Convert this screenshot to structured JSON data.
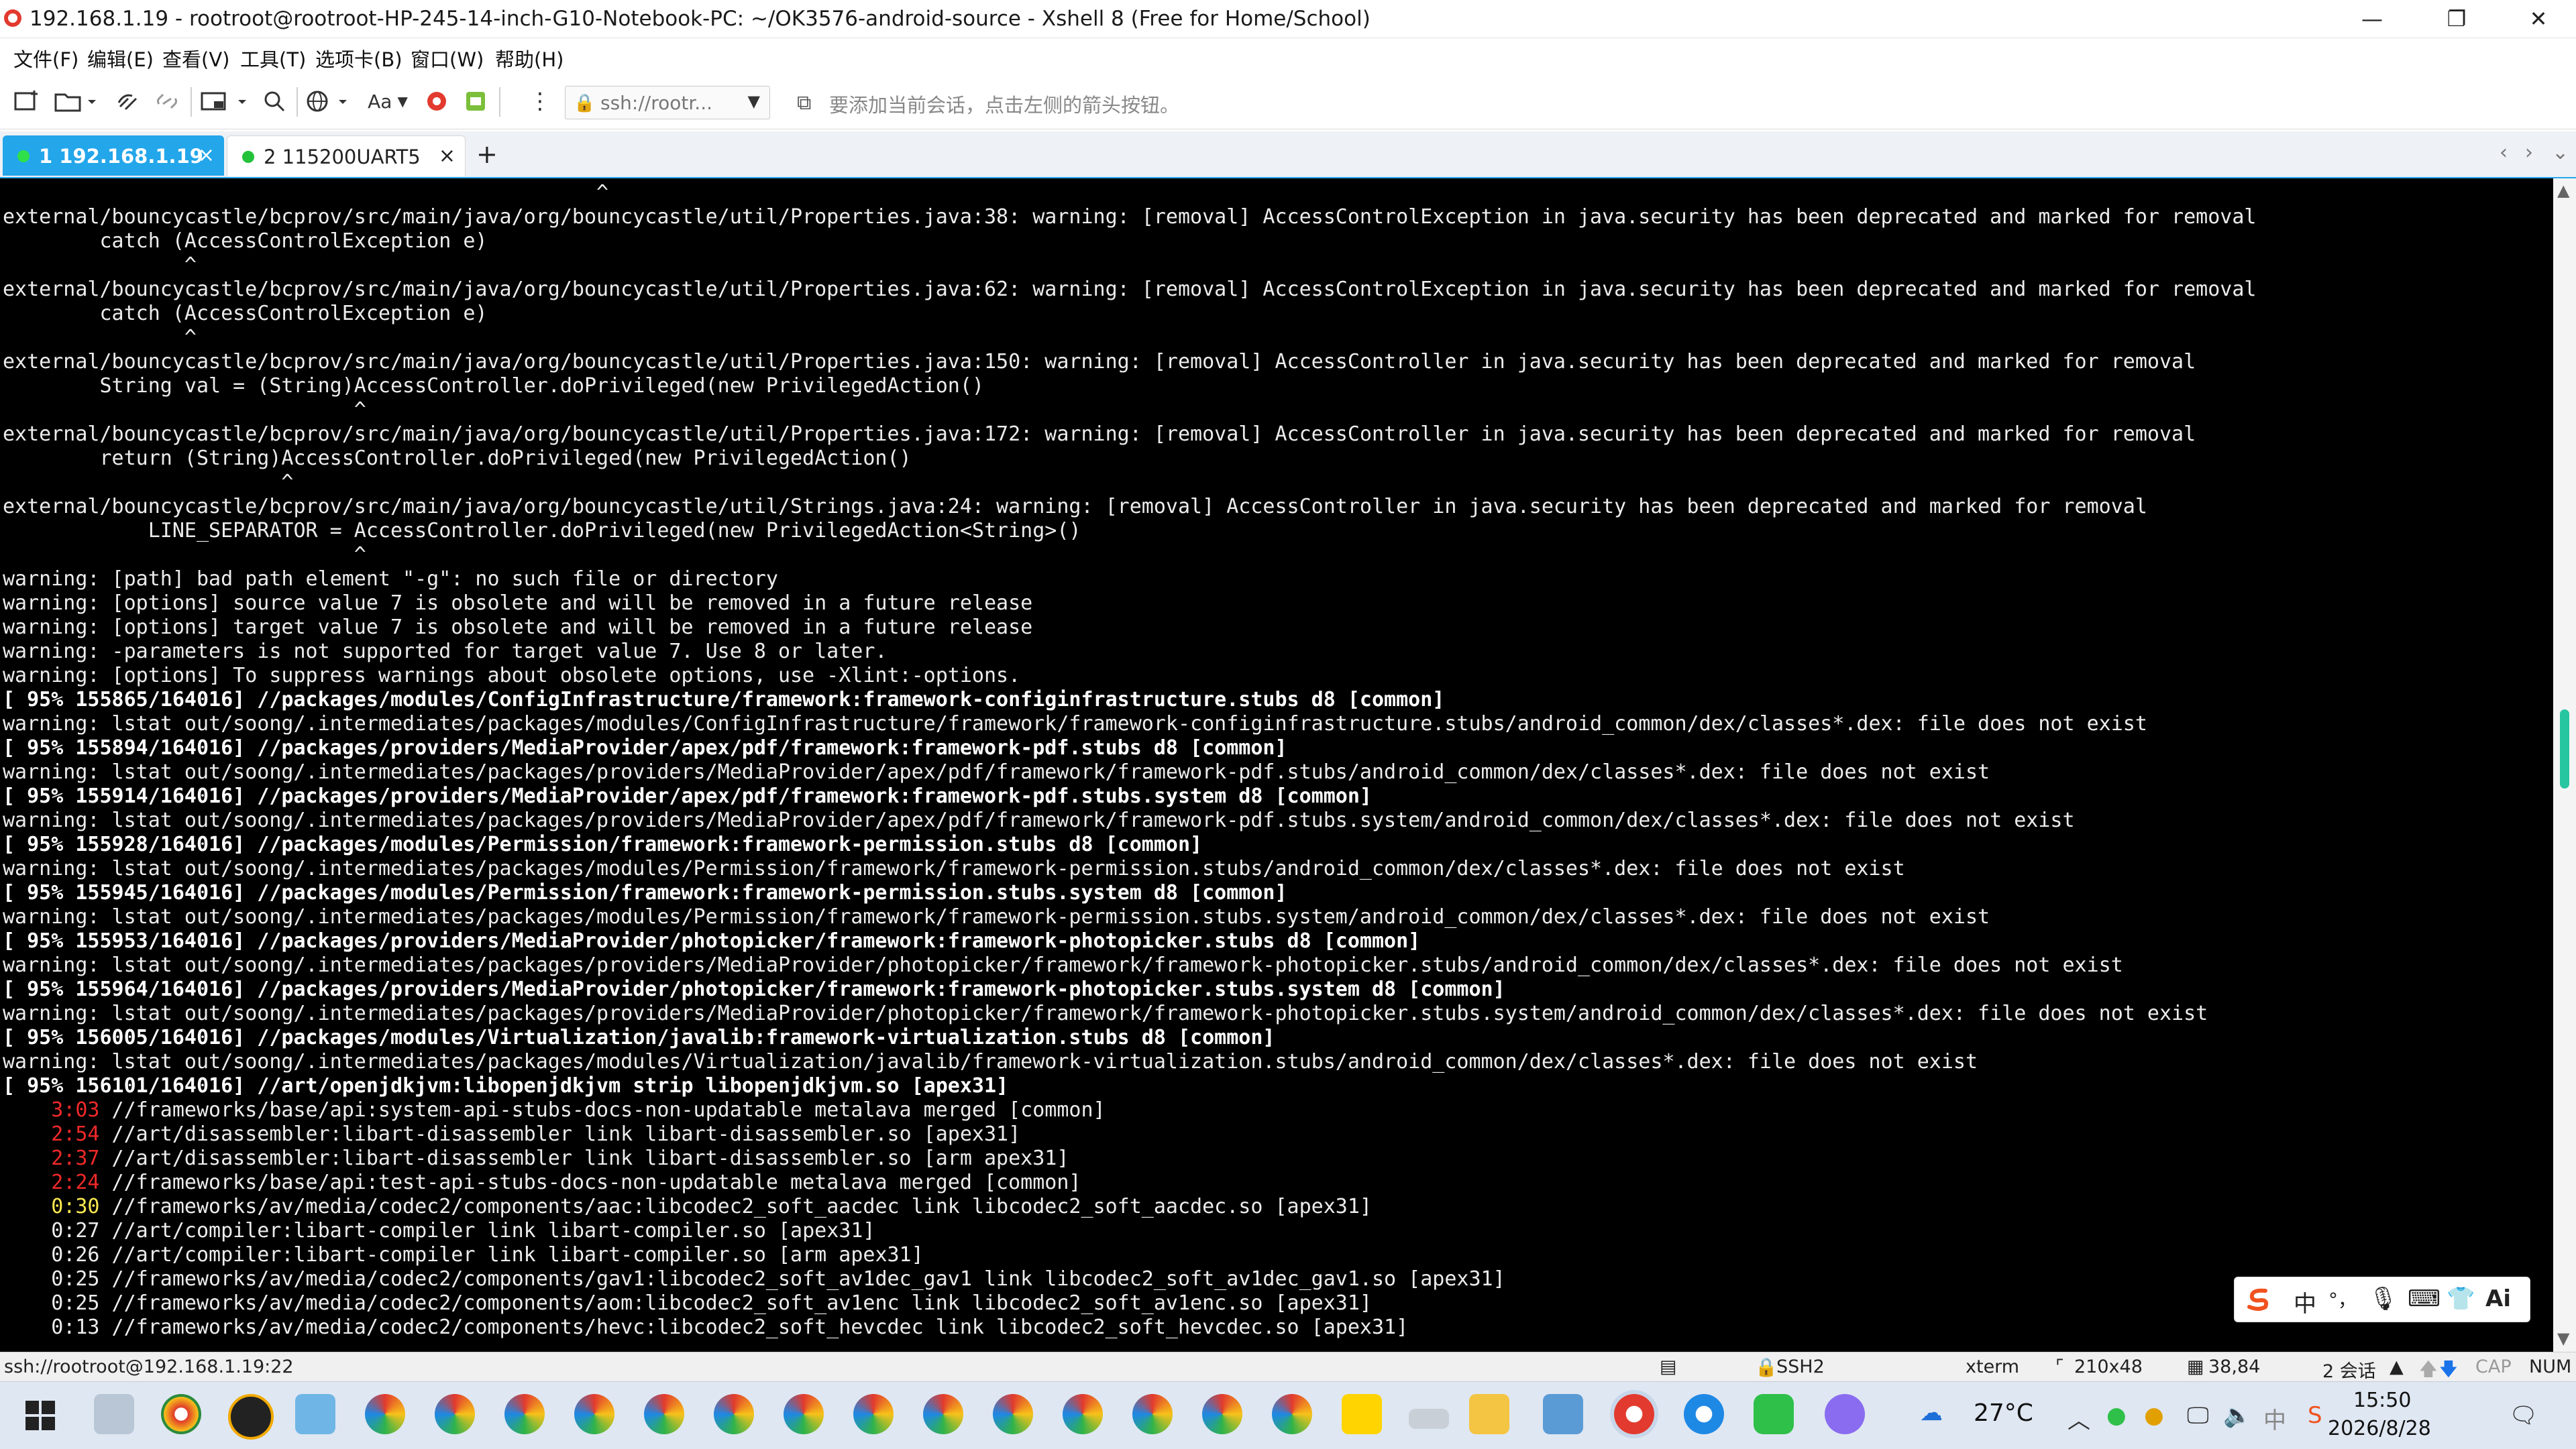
{
  "window": {
    "title": "192.168.1.19 - rootroot@rootroot-HP-245-14-inch-G10-Notebook-PC: ~/OK3576-android-source - Xshell 8 (Free for Home/School)",
    "minimize": "—",
    "maximize": "❐",
    "close": "✕"
  },
  "menu": [
    "文件(F)",
    "编辑(E)",
    "查看(V)",
    "工具(T)",
    "选项卡(B)",
    "窗口(W)",
    "帮助(H)"
  ],
  "toolbar": {
    "address": "ssh://rootr...",
    "address_caret": "▼",
    "hint": "要添加当前会话，点击左侧的箭头按钮。",
    "font_label": "Aa"
  },
  "tabs": [
    {
      "label": "1 192.168.1.19",
      "close": "×"
    },
    {
      "label": "2 115200UART5",
      "close": "×"
    }
  ],
  "tab_add": "+",
  "tab_nav": {
    "prev": "‹",
    "next": "›",
    "menu": "⌄"
  },
  "terminal": {
    "lines": [
      {
        "text": "                                                 ^"
      },
      {
        "text": "external/bouncycastle/bcprov/src/main/java/org/bouncycastle/util/Properties.java:38: warning: [removal] AccessControlException in java.security has been deprecated and marked for removal"
      },
      {
        "text": "        catch (AccessControlException e)"
      },
      {
        "text": "               ^"
      },
      {
        "text": "external/bouncycastle/bcprov/src/main/java/org/bouncycastle/util/Properties.java:62: warning: [removal] AccessControlException in java.security has been deprecated and marked for removal"
      },
      {
        "text": "        catch (AccessControlException e)"
      },
      {
        "text": "               ^"
      },
      {
        "text": "external/bouncycastle/bcprov/src/main/java/org/bouncycastle/util/Properties.java:150: warning: [removal] AccessController in java.security has been deprecated and marked for removal"
      },
      {
        "text": "        String val = (String)AccessController.doPrivileged(new PrivilegedAction()"
      },
      {
        "text": "                             ^"
      },
      {
        "text": "external/bouncycastle/bcprov/src/main/java/org/bouncycastle/util/Properties.java:172: warning: [removal] AccessController in java.security has been deprecated and marked for removal"
      },
      {
        "text": "        return (String)AccessController.doPrivileged(new PrivilegedAction()"
      },
      {
        "text": "                       ^"
      },
      {
        "text": "external/bouncycastle/bcprov/src/main/java/org/bouncycastle/util/Strings.java:24: warning: [removal] AccessController in java.security has been deprecated and marked for removal"
      },
      {
        "text": "            LINE_SEPARATOR = AccessController.doPrivileged(new PrivilegedAction<String>()"
      },
      {
        "text": "                             ^"
      },
      {
        "text": "warning: [path] bad path element \"-g\": no such file or directory"
      },
      {
        "text": "warning: [options] source value 7 is obsolete and will be removed in a future release"
      },
      {
        "text": "warning: [options] target value 7 is obsolete and will be removed in a future release"
      },
      {
        "text": "warning: -parameters is not supported for target value 7. Use 8 or later."
      },
      {
        "text": "warning: [options] To suppress warnings about obsolete options, use -Xlint:-options."
      },
      {
        "text": "[ 95% 155865/164016] //packages/modules/ConfigInfrastructure/framework:framework-configinfrastructure.stubs d8 [common]",
        "bold": true
      },
      {
        "text": "warning: lstat out/soong/.intermediates/packages/modules/ConfigInfrastructure/framework/framework-configinfrastructure.stubs/android_common/dex/classes*.dex: file does not exist"
      },
      {
        "text": "[ 95% 155894/164016] //packages/providers/MediaProvider/apex/pdf/framework:framework-pdf.stubs d8 [common]",
        "bold": true
      },
      {
        "text": "warning: lstat out/soong/.intermediates/packages/providers/MediaProvider/apex/pdf/framework/framework-pdf.stubs/android_common/dex/classes*.dex: file does not exist"
      },
      {
        "text": "[ 95% 155914/164016] //packages/providers/MediaProvider/apex/pdf/framework:framework-pdf.stubs.system d8 [common]",
        "bold": true
      },
      {
        "text": "warning: lstat out/soong/.intermediates/packages/providers/MediaProvider/apex/pdf/framework/framework-pdf.stubs.system/android_common/dex/classes*.dex: file does not exist"
      },
      {
        "text": "[ 95% 155928/164016] //packages/modules/Permission/framework:framework-permission.stubs d8 [common]",
        "bold": true
      },
      {
        "text": "warning: lstat out/soong/.intermediates/packages/modules/Permission/framework/framework-permission.stubs/android_common/dex/classes*.dex: file does not exist"
      },
      {
        "text": "[ 95% 155945/164016] //packages/modules/Permission/framework:framework-permission.stubs.system d8 [common]",
        "bold": true
      },
      {
        "text": "warning: lstat out/soong/.intermediates/packages/modules/Permission/framework/framework-permission.stubs.system/android_common/dex/classes*.dex: file does not exist"
      },
      {
        "text": "[ 95% 155953/164016] //packages/providers/MediaProvider/photopicker/framework:framework-photopicker.stubs d8 [common]",
        "bold": true
      },
      {
        "text": "warning: lstat out/soong/.intermediates/packages/providers/MediaProvider/photopicker/framework/framework-photopicker.stubs/android_common/dex/classes*.dex: file does not exist"
      },
      {
        "text": "[ 95% 155964/164016] //packages/providers/MediaProvider/photopicker/framework:framework-photopicker.stubs.system d8 [common]",
        "bold": true
      },
      {
        "text": "warning: lstat out/soong/.intermediates/packages/providers/MediaProvider/photopicker/framework/framework-photopicker.stubs.system/android_common/dex/classes*.dex: file does not exist"
      },
      {
        "text": "[ 95% 156005/164016] //packages/modules/Virtualization/javalib:framework-virtualization.stubs d8 [common]",
        "bold": true
      },
      {
        "text": "warning: lstat out/soong/.intermediates/packages/modules/Virtualization/javalib/framework-virtualization.stubs/android_common/dex/classes*.dex: file does not exist"
      },
      {
        "text": "[ 95% 156101/164016] //art/openjdkjvm:libopenjdkjvm strip libopenjdkjvm.so [apex31]",
        "bold": true
      },
      {
        "time": "3:03",
        "tcolor": "red",
        "text": " //frameworks/base/api:system-api-stubs-docs-non-updatable metalava merged [common]"
      },
      {
        "time": "2:54",
        "tcolor": "red",
        "text": " //art/disassembler:libart-disassembler link libart-disassembler.so [apex31]"
      },
      {
        "time": "2:37",
        "tcolor": "red",
        "text": " //art/disassembler:libart-disassembler link libart-disassembler.so [arm apex31]"
      },
      {
        "time": "2:24",
        "tcolor": "red",
        "text": " //frameworks/base/api:test-api-stubs-docs-non-updatable metalava merged [common]"
      },
      {
        "time": "0:30",
        "tcolor": "yellow",
        "text": " //frameworks/av/media/codec2/components/aac:libcodec2_soft_aacdec link libcodec2_soft_aacdec.so [apex31]"
      },
      {
        "time": "0:27",
        "tcolor": "",
        "text": " //art/compiler:libart-compiler link libart-compiler.so [apex31]"
      },
      {
        "time": "0:26",
        "tcolor": "",
        "text": " //art/compiler:libart-compiler link libart-compiler.so [arm apex31]"
      },
      {
        "time": "0:25",
        "tcolor": "",
        "text": " //frameworks/av/media/codec2/components/gav1:libcodec2_soft_av1dec_gav1 link libcodec2_soft_av1dec_gav1.so [apex31]"
      },
      {
        "time": "0:25",
        "tcolor": "",
        "text": " //frameworks/av/media/codec2/components/aom:libcodec2_soft_av1enc link libcodec2_soft_av1enc.so [apex31]"
      },
      {
        "time": "0:13",
        "tcolor": "",
        "text": " //frameworks/av/media/codec2/components/hevc:libcodec2_soft_hevcdec link libcodec2_soft_hevcdec.so [apex31]"
      }
    ]
  },
  "ime": {
    "lang": "中",
    "punct": "°，",
    "mic": "🎙",
    "keyboard": "⌨",
    "shirt": "👕",
    "ai": "Ai"
  },
  "statusbar": {
    "connection": "ssh://rootroot@192.168.1.19:22",
    "protocol": "SSH2",
    "term": "xterm",
    "size": "210x48",
    "cursor": "38,84",
    "sessions": "2 会话",
    "cap": "CAP",
    "num": "NUM"
  },
  "taskbar": {
    "weather": "27°C",
    "ime_lang": "中",
    "time": "15:50",
    "date": "2026/8/28"
  },
  "colors": {
    "accent": "#23a6ea",
    "terminal_bg": "#000000",
    "time_red": "#ef2929",
    "time_yellow": "#fce94f",
    "scroll_thumb": "#26c6a0"
  }
}
